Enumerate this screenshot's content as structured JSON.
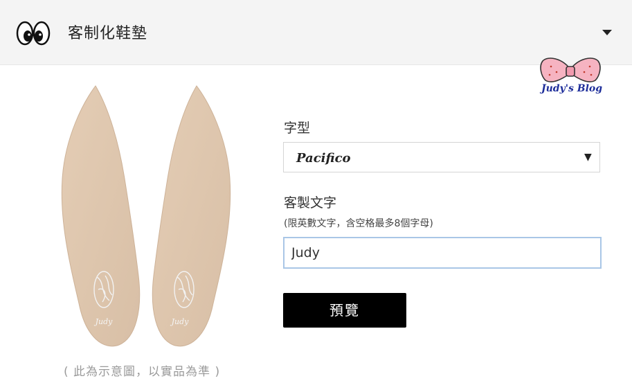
{
  "header": {
    "title": "客制化鞋墊",
    "logo_icon": "eyes-logo-icon",
    "toggle_icon": "caret-down-icon"
  },
  "watermark": {
    "text": "Judy's Blog",
    "icon": "bow-icon"
  },
  "product": {
    "caption": "( 此為示意圖，以實品為準 )",
    "insole_text": "Judy"
  },
  "form": {
    "font_label": "字型",
    "font_value": "Pacifico",
    "text_label": "客製文字",
    "text_hint": "(限英數文字，含空格最多8個字母)",
    "text_value": "Judy",
    "preview_label": "預覽"
  }
}
